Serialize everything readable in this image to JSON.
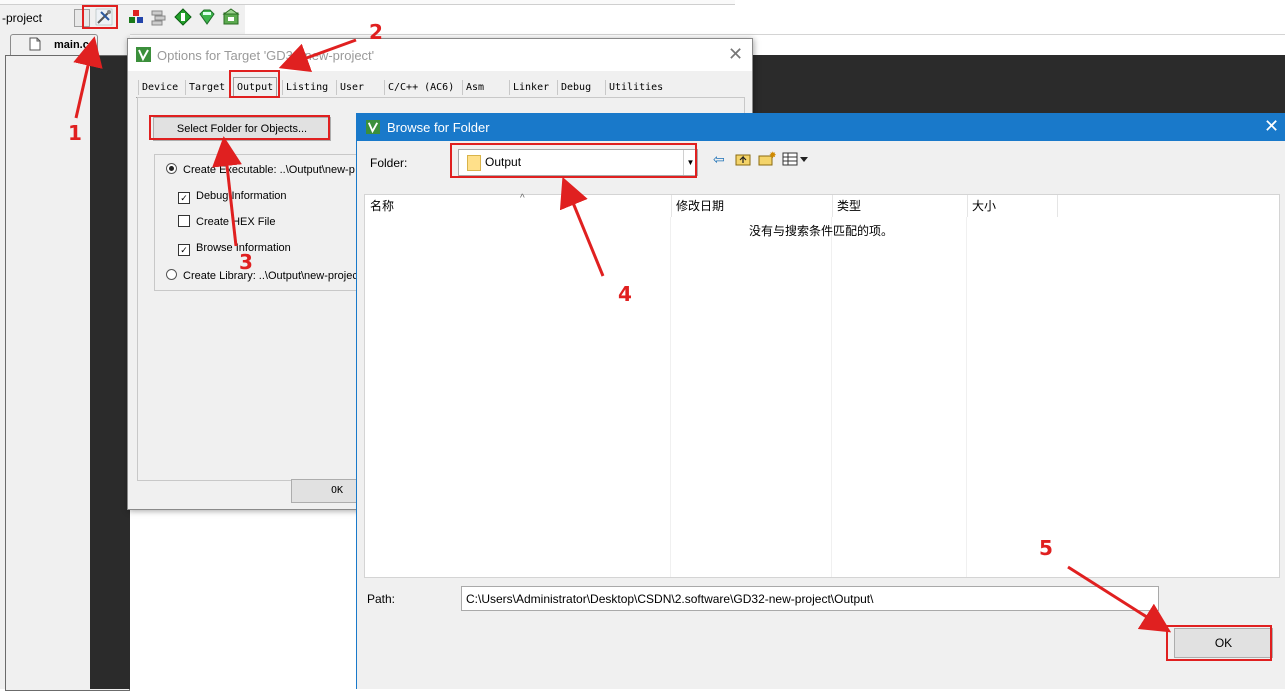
{
  "toolbar": {
    "project_label": "-project"
  },
  "editor": {
    "tab_label": "main.c"
  },
  "options_dialog": {
    "title": "Options for Target 'GD32-new-project'",
    "tabs": [
      "Device",
      "Target",
      "Output",
      "Listing",
      "User",
      "C/C++ (AC6)",
      "Asm",
      "Linker",
      "Debug",
      "Utilities"
    ],
    "active_tab": "Output",
    "select_folder_button": "Select Folder for Objects...",
    "create_executable": "Create Executable:  ..\\Output\\new-p",
    "debug_information": "Debug Information",
    "create_hex": "Create HEX File",
    "browse_information": "Browse Information",
    "create_library": "Create Library:  ..\\Output\\new-projec",
    "ok_button": "OK"
  },
  "browse_dialog": {
    "title": "Browse for Folder",
    "folder_label": "Folder:",
    "folder_value": "Output",
    "columns": [
      "名称",
      "修改日期",
      "类型",
      "大小"
    ],
    "empty_message": "没有与搜索条件匹配的项。",
    "path_label": "Path:",
    "path_value": "C:\\Users\\Administrator\\Desktop\\CSDN\\2.software\\GD32-new-project\\Output\\",
    "ok_button": "OK"
  },
  "annotations": [
    "1",
    "2",
    "3",
    "4",
    "5"
  ],
  "colors": {
    "annotation_red": "#e02020",
    "titlebar_blue": "#1979ca"
  }
}
